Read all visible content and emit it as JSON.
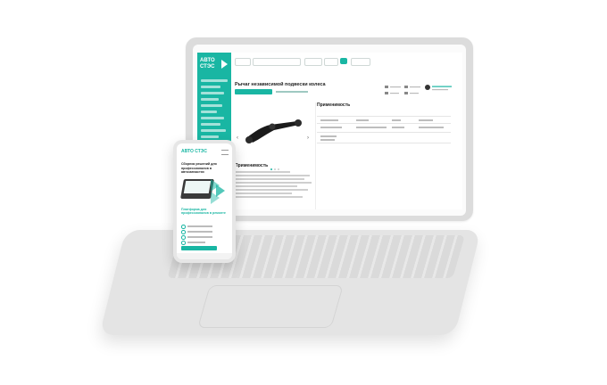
{
  "brand": {
    "name": "АВТО СТЭС",
    "accent_color": "#19b6a3"
  },
  "laptop_site": {
    "page_title": "Рычаг независимой подвески колеса",
    "applicability_title": "Применимость",
    "applicability_title_lower": "Применимость"
  },
  "phone_site": {
    "heading": "Сборник решений для профессионалов в автозапчастях",
    "subheading": "Платформа для профессионалов в ремонте"
  }
}
